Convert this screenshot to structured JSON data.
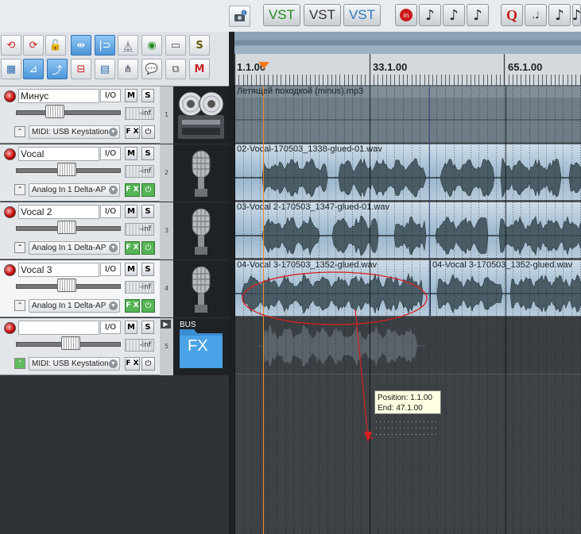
{
  "toolbar": {
    "vst_buttons": [
      "VST",
      "VST",
      "VST"
    ],
    "quantize_label": "Q"
  },
  "ruler": {
    "markers": [
      "1.1.00",
      "33.1.00",
      "65.1.00"
    ]
  },
  "tracks": [
    {
      "name": "Минус",
      "io": "I/O",
      "mute": "M",
      "solo": "S",
      "volume_db": "-inf",
      "input": "MIDI: USB Keystation",
      "fx": "F X",
      "number": "1",
      "icon": "tape-recorder-icon",
      "selected": false,
      "fader_level": 0.46
    },
    {
      "name": "Vocal",
      "io": "I/O",
      "mute": "M",
      "solo": "S",
      "volume_db": "-inf",
      "input": "Analog In 1 Delta-AP",
      "fx": "F X",
      "number": "2",
      "icon": "microphone-icon",
      "selected": false,
      "fader_level": 0.6
    },
    {
      "name": "Vocal 2",
      "io": "I/O",
      "mute": "M",
      "solo": "S",
      "volume_db": "-inf",
      "input": "Analog In 1 Delta-AP",
      "fx": "F X",
      "number": "3",
      "icon": "microphone-icon",
      "selected": false,
      "fader_level": 0.6
    },
    {
      "name": "Vocal 3",
      "io": "I/O",
      "mute": "M",
      "solo": "S",
      "volume_db": "-inf",
      "input": "Analog In 1 Delta-AP",
      "fx": "F X",
      "number": "4",
      "icon": "microphone-icon",
      "selected": true,
      "fader_level": 0.6
    },
    {
      "name": "",
      "io": "I/O",
      "mute": "M",
      "solo": "S",
      "volume_db": "-inf",
      "input": "MIDI: USB Keystation",
      "fx": "F X",
      "number": "5",
      "icon": "bus-fx-folder-icon",
      "selected": false,
      "fader_level": 0.65
    }
  ],
  "bus_icon": {
    "top": "BUS",
    "label": "FX"
  },
  "clips": [
    {
      "name": "Летящей походкой (minus).mp3"
    },
    {
      "name": "02-Vocal-170503_1338-glued-01.wav"
    },
    {
      "name": "03-Vocal 2-170503_1347-glued-01.wav"
    },
    {
      "name": "04-Vocal 3-170503_1352-glued.wav"
    },
    {
      "name": "04-Vocal 3-170503_1352-glued.wav"
    }
  ],
  "tooltip": {
    "position": "Position: 1.1.00",
    "end": "End: 47.1.00"
  },
  "colors": {
    "clip_bg": "#a9c2d6",
    "waveform": "#4a5d66",
    "playhead": "#f08a24",
    "annotation": "#d82020"
  }
}
